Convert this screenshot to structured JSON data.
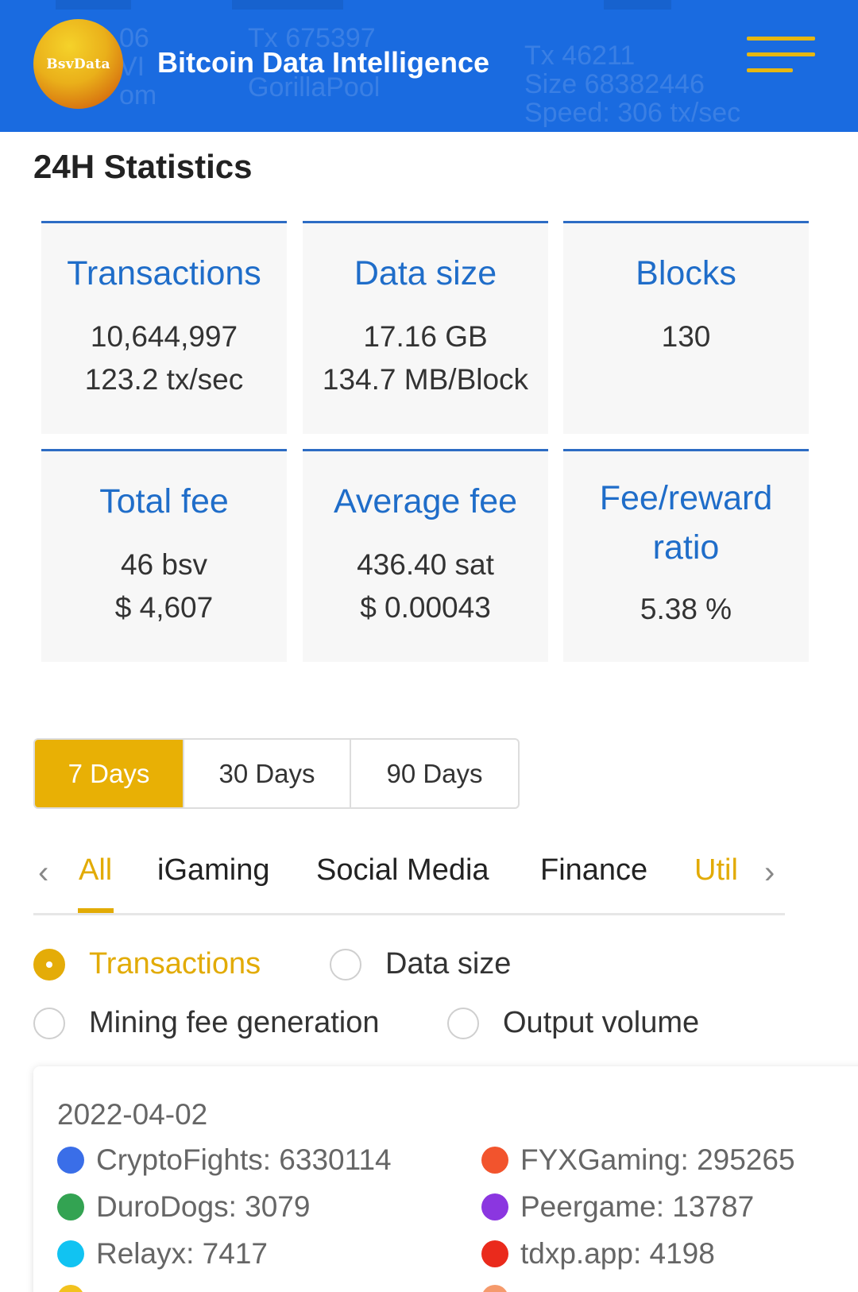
{
  "header": {
    "logo_text": "BsvData",
    "title": "Bitcoin Data Intelligence",
    "menu_icon": "hamburger-menu-icon",
    "ticker": {
      "col1": [
        "06",
        "VI",
        "om"
      ],
      "col2": [
        "Tx 675397",
        "GorillaPool"
      ],
      "col3": [
        "Tx 46211",
        "Size 68382446",
        "Speed: 306 tx/sec"
      ]
    }
  },
  "stats": {
    "title": "24H Statistics",
    "cards": [
      {
        "label": "Transactions",
        "values": [
          "10,644,997",
          "123.2 tx/sec"
        ]
      },
      {
        "label": "Data size",
        "values": [
          "17.16 GB",
          "134.7 MB/Block"
        ]
      },
      {
        "label": "Blocks",
        "values": [
          "130"
        ]
      },
      {
        "label": "Total fee",
        "values": [
          "46 bsv",
          "$ 4,607"
        ]
      },
      {
        "label": "Average fee",
        "values": [
          "436.40 sat",
          "$ 0.00043"
        ]
      },
      {
        "label_lines": [
          "Fee/reward",
          "ratio"
        ],
        "values": [
          "5.38 %"
        ]
      }
    ]
  },
  "periods": {
    "options": [
      "7 Days",
      "30 Days",
      "90 Days"
    ],
    "selected": "7 Days"
  },
  "categories": {
    "tabs": [
      "All",
      "iGaming",
      "Social Media",
      "Finance",
      "Util"
    ],
    "selected": "All",
    "prev_icon": "chevron-left-icon",
    "next_icon": "chevron-right-icon"
  },
  "metrics": {
    "options": [
      "Transactions",
      "Data size",
      "Mining fee generation",
      "Output volume"
    ],
    "selected": "Transactions"
  },
  "tooltip": {
    "date": "2022-04-02",
    "entries": [
      {
        "name": "CryptoFights",
        "value": "6330114",
        "color": "#3a6ee8"
      },
      {
        "name": "FYXGaming",
        "value": "295265",
        "color": "#f2542d"
      },
      {
        "name": "DuroDogs",
        "value": "3079",
        "color": "#33a352"
      },
      {
        "name": "Peergame",
        "value": "13787",
        "color": "#8b36e0"
      },
      {
        "name": "Relayx",
        "value": "7417",
        "color": "#11c3f2"
      },
      {
        "name": "tdxp.app",
        "value": "4198",
        "color": "#ea2a1c"
      }
    ],
    "partial_colors": [
      "#f2c21e",
      "#f59a6c"
    ]
  },
  "colors": {
    "header_bg": "#1a6be0",
    "accent": "#e8b005",
    "card_label": "#1f6dc9"
  }
}
